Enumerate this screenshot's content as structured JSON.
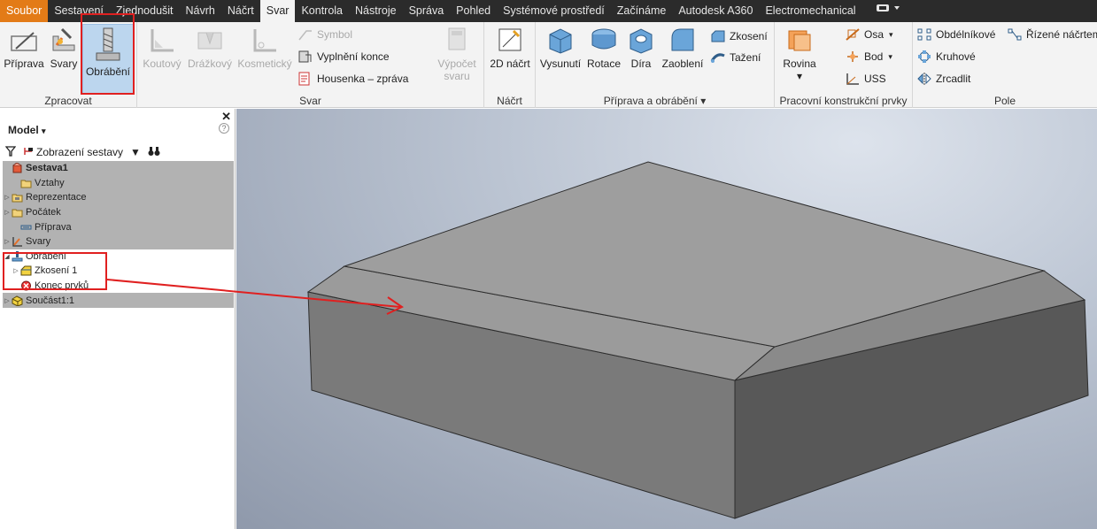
{
  "menu": {
    "tabs": [
      "Soubor",
      "Sestavení",
      "Zjednodušit",
      "Návrh",
      "Náčrt",
      "Svar",
      "Kontrola",
      "Nástroje",
      "Správa",
      "Pohled",
      "Systémové prostředí",
      "Začínáme",
      "Autodesk A360",
      "Electromechanical"
    ],
    "active": "Svar"
  },
  "ribbon": {
    "zpracovat": {
      "title": "Zpracovat",
      "priprava": "Příprava",
      "svary": "Svary",
      "obrabeni": "Obrábění"
    },
    "svar": {
      "title": "Svar",
      "koutovy": "Koutový",
      "drazkovy": "Drážkový",
      "kosmeticky": "Kosmetický",
      "symbol": "Symbol",
      "vyplneni": "Vyplnění konce",
      "housenka": "Housenka – zpráva",
      "vypocet_1": "Výpočet",
      "vypocet_2": "svaru"
    },
    "nacrt": {
      "title": "Náčrt",
      "nacrt2d": "2D náčrt"
    },
    "priprava_obrabeni": {
      "title": "Příprava a obrábění",
      "vysunuti": "Vysunutí",
      "rotace": "Rotace",
      "dira": "Díra",
      "zaobleni": "Zaoblení",
      "zkoseni": "Zkosení",
      "tazeni": "Tažení"
    },
    "pracovni": {
      "title": "Pracovní konstrukční prvky",
      "rovina": "Rovina",
      "osa": "Osa",
      "bod": "Bod",
      "uss": "USS"
    },
    "pole": {
      "title": "Pole",
      "obdelnikove": "Obdélníkové",
      "rizene": "Řízené náčrtem",
      "kruhove": "Kruhové",
      "zrcadlit": "Zrcadlit"
    }
  },
  "panel": {
    "title": "Model",
    "help": "?",
    "view_label": "Zobrazení sestavy",
    "tree": [
      {
        "label": "Sestava1",
        "level": 0,
        "bold": true,
        "grey": true,
        "expander": "",
        "icon": "assembly-icon"
      },
      {
        "label": "Vztahy",
        "level": 1,
        "bold": false,
        "grey": true,
        "expander": "",
        "icon": "folder-icon"
      },
      {
        "label": "Reprezentace",
        "level": 1,
        "bold": false,
        "grey": true,
        "expander": "▷",
        "icon": "representation-icon"
      },
      {
        "label": "Počátek",
        "level": 1,
        "bold": false,
        "grey": true,
        "expander": "▷",
        "icon": "folder-icon"
      },
      {
        "label": "Příprava",
        "level": 1,
        "bold": false,
        "grey": true,
        "expander": "",
        "icon": "preparation-icon"
      },
      {
        "label": "Svary",
        "level": 1,
        "bold": false,
        "grey": true,
        "expander": "▷",
        "icon": "welds-icon"
      },
      {
        "label": "Obrábění",
        "level": 1,
        "bold": false,
        "grey": false,
        "expander": "◢",
        "icon": "machining-icon"
      },
      {
        "label": "Zkosení 1",
        "level": 2,
        "bold": false,
        "grey": false,
        "expander": "▷",
        "icon": "chamfer-icon"
      },
      {
        "label": "Konec prvků",
        "level": 2,
        "bold": false,
        "grey": false,
        "expander": "",
        "icon": "end-of-features-icon"
      },
      {
        "label": "Součást1:1",
        "level": 1,
        "bold": false,
        "grey": true,
        "expander": "▷",
        "icon": "part-icon"
      }
    ]
  }
}
